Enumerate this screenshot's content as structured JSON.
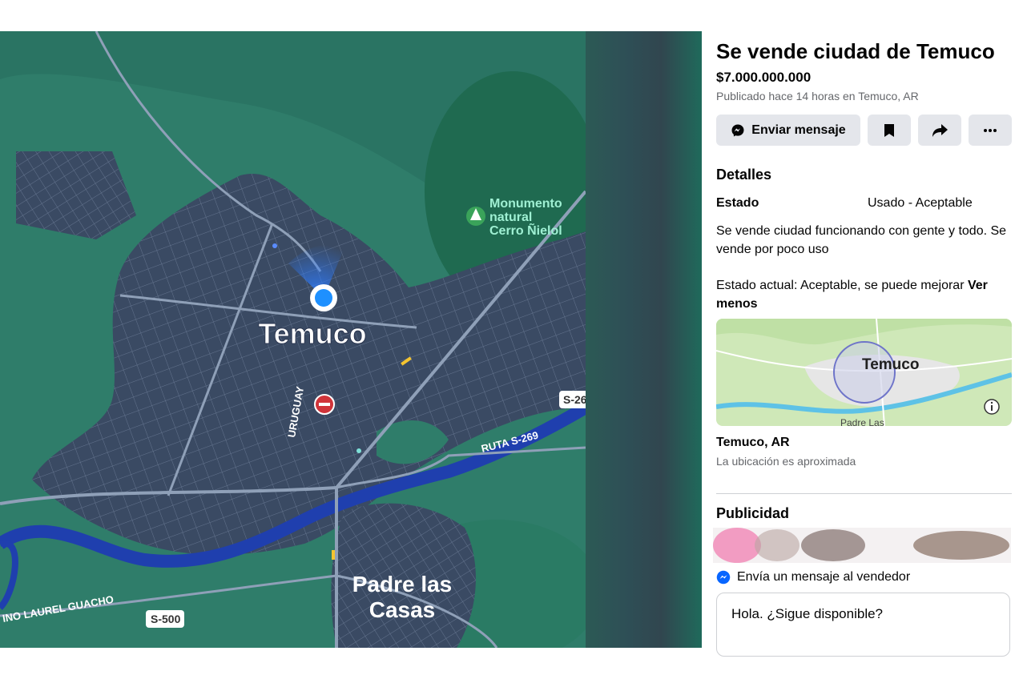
{
  "map": {
    "city_label": "Temuco",
    "town_label": "Padre las Casas",
    "town_label_line1": "Padre las",
    "town_label_line2": "Casas",
    "poi_label_lines": [
      "Monumento",
      "natural",
      "Cerro Ñielol"
    ],
    "road_labels": [
      "URUGUAY",
      "RUTA S-269",
      "S-269",
      "S-500",
      "INO LAUREL GUACHO"
    ],
    "route_badge_1": "S-26",
    "route_badge_2": "S-500",
    "colors": {
      "land": "#2f7d6a",
      "city": "#3a4a63",
      "river": "#1f3fae",
      "road": "#8fa0b8"
    }
  },
  "listing": {
    "title": "Se vende ciudad de Temuco",
    "price": "$7.000.000.000",
    "posted": "Publicado hace 14 horas en Temuco, AR",
    "actions": {
      "message_label": "Enviar mensaje"
    },
    "details": {
      "heading": "Detalles",
      "condition_label": "Estado",
      "condition_value": "Usado - Aceptable",
      "description_1": "Se vende ciudad funcionando con gente y todo. Se vende por poco uso",
      "description_2": "Estado actual: Aceptable, se puede mejorar",
      "see_less": "Ver menos"
    },
    "location": {
      "minimap_city": "Temuco",
      "minimap_town": "Padre Las",
      "name": "Temuco, AR",
      "note": "La ubicación es aproximada"
    },
    "ads_heading": "Publicidad",
    "seller_message": {
      "heading": "Envía un mensaje al vendedor",
      "text": "Hola. ¿Sigue disponible?"
    }
  },
  "colors": {
    "accent": "#0866ff",
    "button_bg": "#e4e6eb",
    "secondary_text": "#65676b"
  }
}
